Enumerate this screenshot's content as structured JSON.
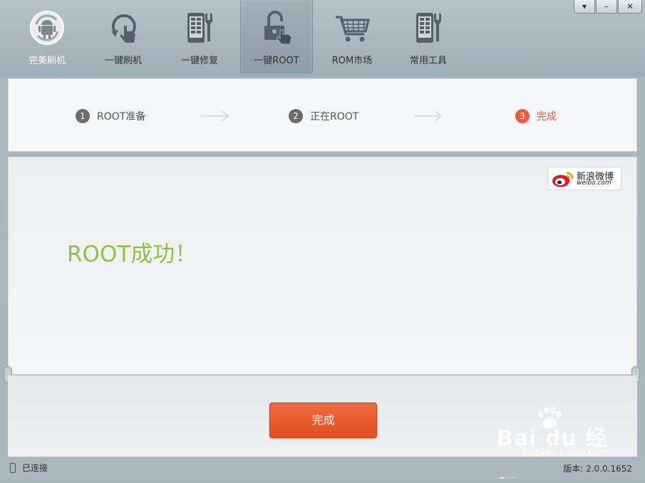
{
  "toolbar": {
    "items": [
      {
        "label": "完美刷机",
        "icon": "android-refresh-icon"
      },
      {
        "label": "一键刷机",
        "icon": "refresh-hand-icon"
      },
      {
        "label": "一键修复",
        "icon": "phone-wrench-icon"
      },
      {
        "label": "一键ROOT",
        "icon": "unlock-hand-icon",
        "active": true
      },
      {
        "label": "ROM市场",
        "icon": "cart-icon"
      },
      {
        "label": "常用工具",
        "icon": "phone-tools-icon"
      }
    ],
    "window_buttons": {
      "menu": "▾",
      "minimize": "–",
      "close": "✕"
    }
  },
  "steps": {
    "items": [
      {
        "num": "1",
        "label": "ROOT准备"
      },
      {
        "num": "2",
        "label": "正在ROOT"
      },
      {
        "num": "3",
        "label": "完成",
        "current": true
      }
    ]
  },
  "content": {
    "weibo_text": "新浪微博",
    "weibo_url": "weibo.com",
    "success_message": "ROOT成功！"
  },
  "footer": {
    "done_label": "完成"
  },
  "watermark": {
    "brand": "Bai du 经验",
    "url": "jingyan.baidu.com"
  },
  "status": {
    "connection": "已连接",
    "version": "版本: 2.0.0.1652"
  },
  "colors": {
    "accent": "#ee5a3e",
    "success": "#8cc33f",
    "toolbar": "#a9b6bd"
  }
}
